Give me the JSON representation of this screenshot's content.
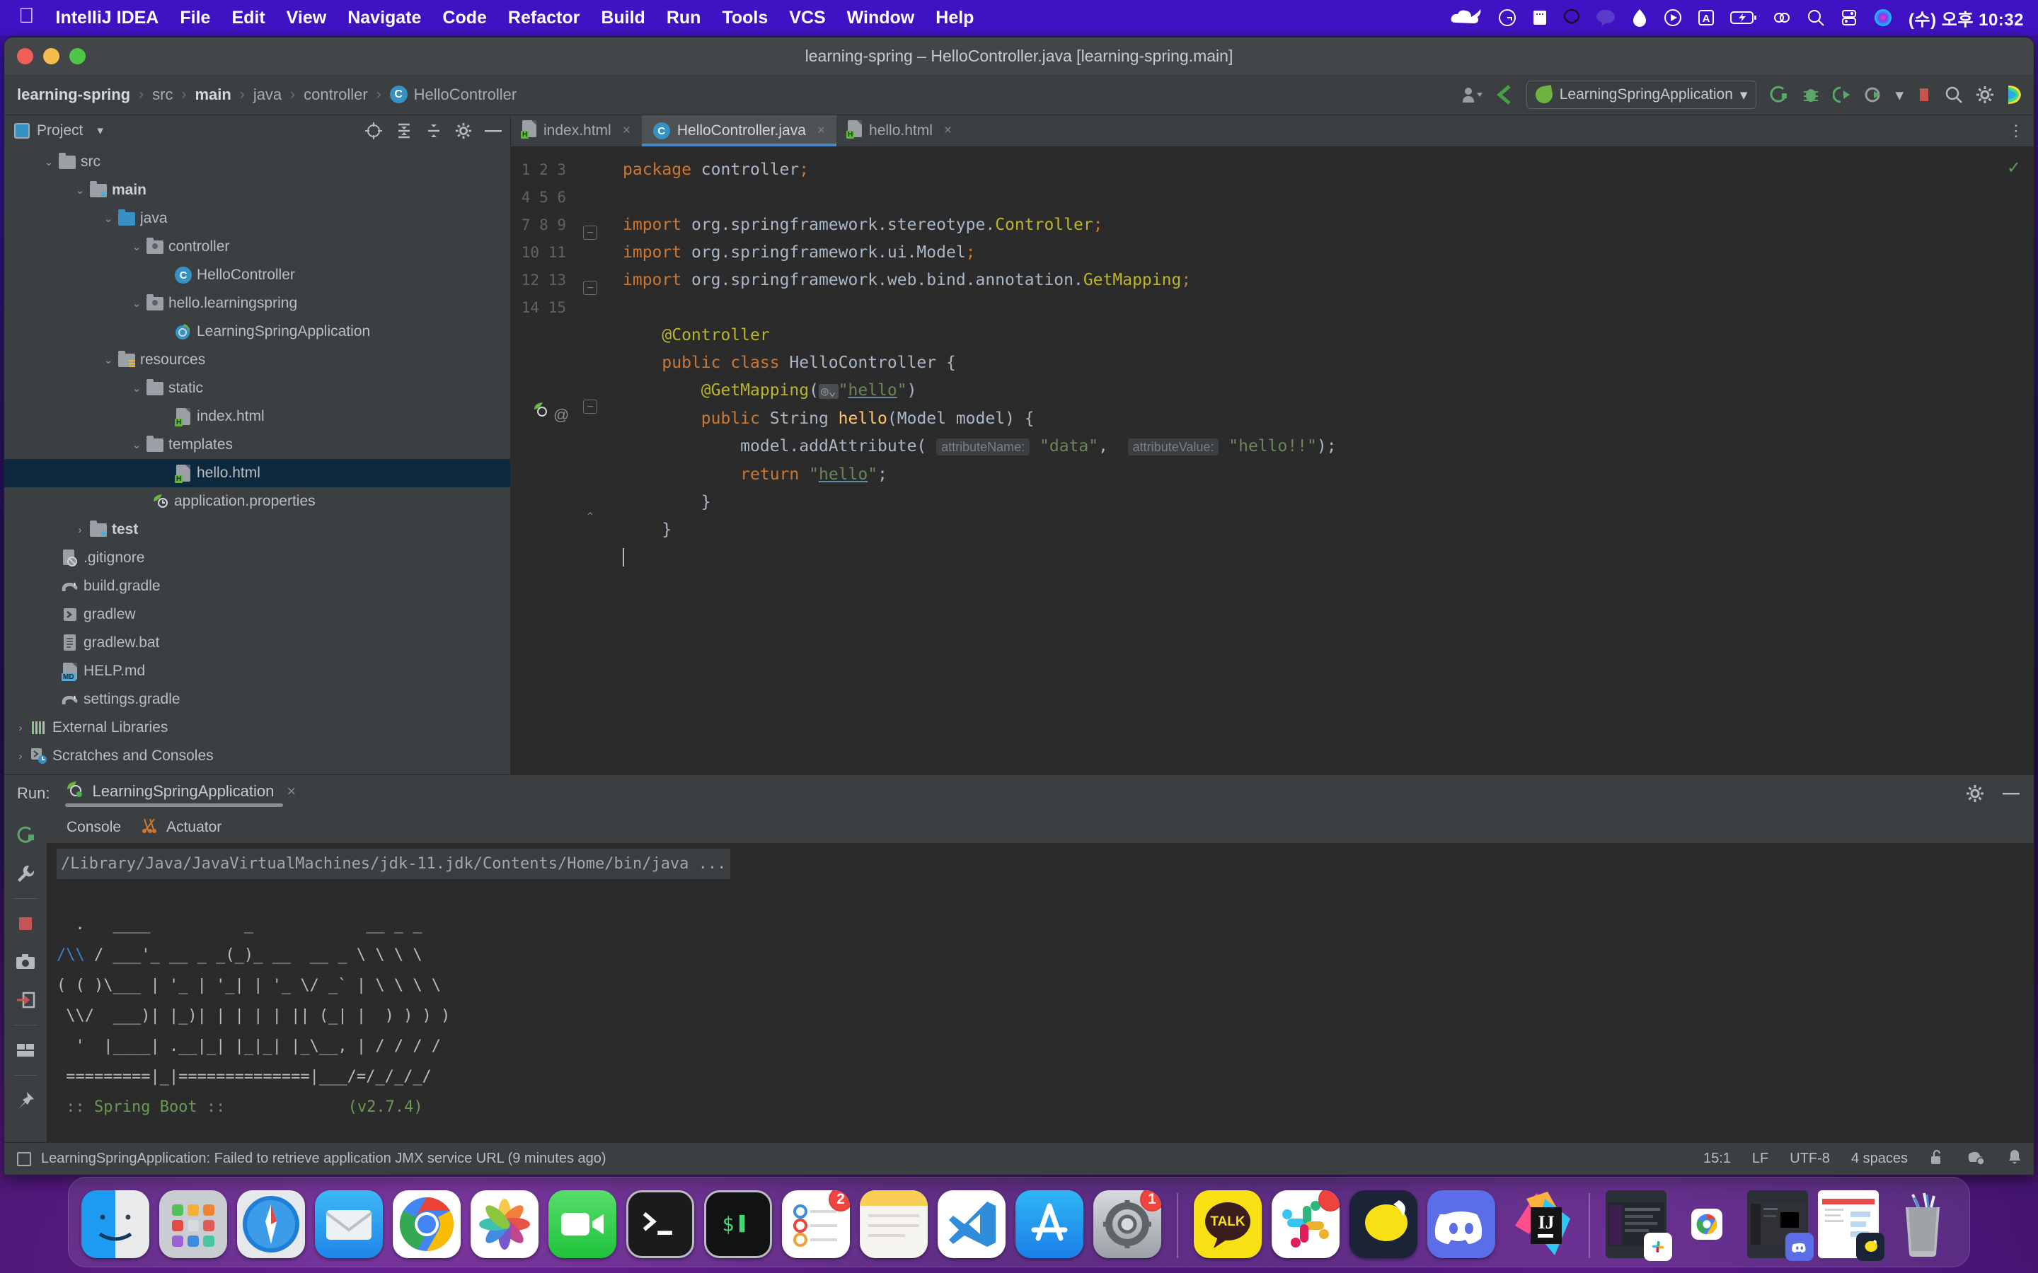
{
  "menubar": {
    "apple_icon": "apple-icon",
    "app_name": "IntelliJ IDEA",
    "items": [
      "File",
      "Edit",
      "View",
      "Navigate",
      "Code",
      "Refactor",
      "Build",
      "Run",
      "Tools",
      "VCS",
      "Window",
      "Help"
    ],
    "tray_icons": [
      "cloud-icon",
      "grammarly-icon",
      "notes-icon",
      "alien-icon",
      "chat-bubble-icon",
      "droplet-icon",
      "play-circle-icon",
      "letter-a-icon",
      "battery-charging-icon",
      "bluetooth-icon",
      "search-icon",
      "control-center-icon",
      "siri-icon"
    ],
    "clock": "(수) 오후 10:32"
  },
  "window": {
    "title": "learning-spring – HelloController.java [learning-spring.main]",
    "traffic_lights": [
      "close-button",
      "minimize-button",
      "zoom-button"
    ]
  },
  "breadcrumb": {
    "items": [
      "learning-spring",
      "src",
      "main",
      "java",
      "controller",
      "HelloController"
    ],
    "separator": "›",
    "class_badge": "C"
  },
  "toolbar": {
    "right_icons": [
      "user-account-icon",
      "chevron-down-icon",
      "update-project-icon"
    ],
    "run_config": "LearningSpringApplication",
    "run_config_caret": "▾",
    "action_icons": [
      "run-icon",
      "debug-icon",
      "run-with-coverage-icon",
      "profile-icon",
      "chevron-down-icon",
      "stop-icon",
      "search-everywhere-icon",
      "settings-gear-icon",
      "ide-logo-icon"
    ]
  },
  "project_panel": {
    "title": "Project",
    "caret": "▾",
    "header_icons": [
      "locate-icon",
      "expand-all-icon",
      "collapse-all-icon",
      "gear-icon",
      "hide-icon"
    ],
    "tree": [
      {
        "label": "src",
        "depth": 1,
        "arrow": "v",
        "icon": "folder",
        "bold": false
      },
      {
        "label": "main",
        "depth": 2,
        "arrow": "v",
        "icon": "folder-src",
        "bold": true
      },
      {
        "label": "java",
        "depth": 3,
        "arrow": "v",
        "icon": "folder-blue",
        "bold": false
      },
      {
        "label": "controller",
        "depth": 4,
        "arrow": "v",
        "icon": "package",
        "bold": false
      },
      {
        "label": "HelloController",
        "depth": 5,
        "arrow": "",
        "icon": "class",
        "bold": false
      },
      {
        "label": "hello.learningspring",
        "depth": 4,
        "arrow": "v",
        "icon": "package",
        "bold": false
      },
      {
        "label": "LearningSpringApplication",
        "depth": 5,
        "arrow": "",
        "icon": "spring-class",
        "bold": false
      },
      {
        "label": "resources",
        "depth": 3,
        "arrow": "v",
        "icon": "folder-res",
        "bold": false
      },
      {
        "label": "static",
        "depth": 4,
        "arrow": "v",
        "icon": "folder",
        "bold": false
      },
      {
        "label": "index.html",
        "depth": 5,
        "arrow": "",
        "icon": "html-file",
        "bold": false
      },
      {
        "label": "templates",
        "depth": 4,
        "arrow": "v",
        "icon": "folder",
        "bold": false
      },
      {
        "label": "hello.html",
        "depth": 5,
        "arrow": "",
        "icon": "html-file",
        "bold": false,
        "selected": true
      },
      {
        "label": "application.properties",
        "depth": 4,
        "arrow": "",
        "icon": "spring-props",
        "bold": false
      },
      {
        "label": "test",
        "depth": 2,
        "arrow": ">",
        "icon": "folder-src",
        "bold": true
      },
      {
        "label": ".gitignore",
        "depth": 2,
        "arrow": "",
        "icon": "gitignore-file",
        "bold": false
      },
      {
        "label": "build.gradle",
        "depth": 2,
        "arrow": "",
        "icon": "gradle-file",
        "bold": false
      },
      {
        "label": "gradlew",
        "depth": 2,
        "arrow": "",
        "icon": "script-file",
        "bold": false
      },
      {
        "label": "gradlew.bat",
        "depth": 2,
        "arrow": "",
        "icon": "bat-file",
        "bold": false
      },
      {
        "label": "HELP.md",
        "depth": 2,
        "arrow": "",
        "icon": "md-file",
        "bold": false
      },
      {
        "label": "settings.gradle",
        "depth": 2,
        "arrow": "",
        "icon": "gradle-file",
        "bold": false
      },
      {
        "label": "External Libraries",
        "depth": 1,
        "arrow": ">",
        "icon": "libraries",
        "bold": false
      },
      {
        "label": "Scratches and Consoles",
        "depth": 1,
        "arrow": ">",
        "icon": "scratches",
        "bold": false
      }
    ]
  },
  "editor": {
    "tabs": [
      {
        "label": "index.html",
        "icon": "html-file",
        "active": false,
        "close": "×"
      },
      {
        "label": "HelloController.java",
        "icon": "class",
        "active": true,
        "close": "×"
      },
      {
        "label": "hello.html",
        "icon": "html-file",
        "active": false,
        "close": "×"
      }
    ],
    "kebab": "⋮",
    "inspection_ok": "✓",
    "line_numbers": [
      "1",
      "2",
      "3",
      "4",
      "5",
      "6",
      "7",
      "8",
      "9",
      "10",
      "11",
      "12",
      "13",
      "14",
      "15"
    ],
    "code_lines": [
      "package controller;",
      "",
      "import org.springframework.stereotype.Controller;",
      "import org.springframework.ui.Model;",
      "import org.springframework.web.bind.annotation.GetMapping;",
      "",
      "@Controller",
      "public class HelloController {",
      "    @GetMapping(\"hello\")",
      "    public String hello(Model model) {",
      "        model.addAttribute( attributeName: \"data\",  attributeValue: \"hello!!\");",
      "        return \"hello\";",
      "    }",
      "}",
      ""
    ],
    "param_hints": [
      "attributeName:",
      "attributeValue:"
    ],
    "gutter_markers": [
      "spring-bean-icon",
      "annotation-icon"
    ]
  },
  "run_panel": {
    "label": "Run:",
    "tab_name": "LearningSpringApplication",
    "tab_close": "×",
    "header_icons": [
      "settings-gear-icon",
      "minimize-icon"
    ],
    "side_icons": [
      "rerun-icon",
      "wrench-icon",
      "stop-icon",
      "camera-icon",
      "export-icon",
      "layout-icon",
      "pin-icon",
      "scroll-up-icon",
      "scroll-down-icon",
      "soft-wrap-icon",
      "scroll-to-end-icon",
      "print-icon",
      "trash-icon"
    ],
    "sub_tabs": [
      {
        "label": "Console",
        "icon": "console-icon"
      },
      {
        "label": "Actuator",
        "icon": "actuator-icon"
      }
    ],
    "console": {
      "command": "/Library/Java/JavaVirtualMachines/jdk-11.jdk/Contents/Home/bin/java ...",
      "banner": [
        "  .   ____          _            __ _ _",
        " /\\\\ / ___'_ __ _ _(_)_ __  __ _ \\ \\ \\ \\",
        "( ( )\\___ | '_ | '_| | '_ \\/ _` | \\ \\ \\ \\",
        " \\\\/  ___)| |_)| | | | | || (_| |  ) ) ) )",
        "  '  |____| .__|_| |_|_| |_\\__, | / / / /",
        " =========|_|==============|___/=/_/_/_/"
      ],
      "footer_left": " :: Spring Boot :: ",
      "footer_right": "(v2.7.4)"
    }
  },
  "status_bar": {
    "icon": "window-icon",
    "message": "LearningSpringApplication: Failed to retrieve application JMX service URL (9 minutes ago)",
    "caret_position": "15:1",
    "line_separator": "LF",
    "encoding": "UTF-8",
    "indent": "4 spaces",
    "right_icons": [
      "lock-open-icon",
      "inspection-settings-icon",
      "notifications-bell-icon"
    ]
  },
  "dock": {
    "apps": [
      {
        "name": "finder",
        "label": "Finder",
        "running": true
      },
      {
        "name": "launchpad",
        "label": "Launchpad",
        "running": false
      },
      {
        "name": "safari",
        "label": "Safari",
        "running": false
      },
      {
        "name": "mail",
        "label": "Mail",
        "running": false
      },
      {
        "name": "chrome",
        "label": "Google Chrome",
        "running": true
      },
      {
        "name": "photos",
        "label": "Photos",
        "running": false
      },
      {
        "name": "facetime",
        "label": "FaceTime",
        "running": false
      },
      {
        "name": "terminal",
        "label": "Terminal",
        "running": true
      },
      {
        "name": "iterm",
        "label": "iTerm",
        "running": false
      },
      {
        "name": "reminders",
        "label": "Reminders",
        "running": true,
        "badge": "2"
      },
      {
        "name": "notes",
        "label": "Notes",
        "running": false
      },
      {
        "name": "vscode",
        "label": "Visual Studio Code",
        "running": false
      },
      {
        "name": "appstore",
        "label": "App Store",
        "running": false
      },
      {
        "name": "system-preferences",
        "label": "System Preferences",
        "running": true,
        "badge": "1"
      },
      {
        "name": "kakaotalk",
        "label": "KakaoTalk",
        "running": true
      },
      {
        "name": "slack",
        "label": "Slack",
        "running": true,
        "badge": ""
      },
      {
        "name": "kakao-chat",
        "label": "Kakao",
        "running": false
      },
      {
        "name": "discord",
        "label": "Discord",
        "running": true
      },
      {
        "name": "intellij-idea",
        "label": "IntelliJ IDEA",
        "running": true
      }
    ],
    "minimized": [
      {
        "name": "slack-window",
        "label": "Slack window"
      },
      {
        "name": "chrome-window",
        "label": "Chrome window"
      },
      {
        "name": "discord-window",
        "label": "Discord window"
      },
      {
        "name": "kakao-window",
        "label": "Kakao window"
      }
    ],
    "trash": "trash-icon"
  }
}
